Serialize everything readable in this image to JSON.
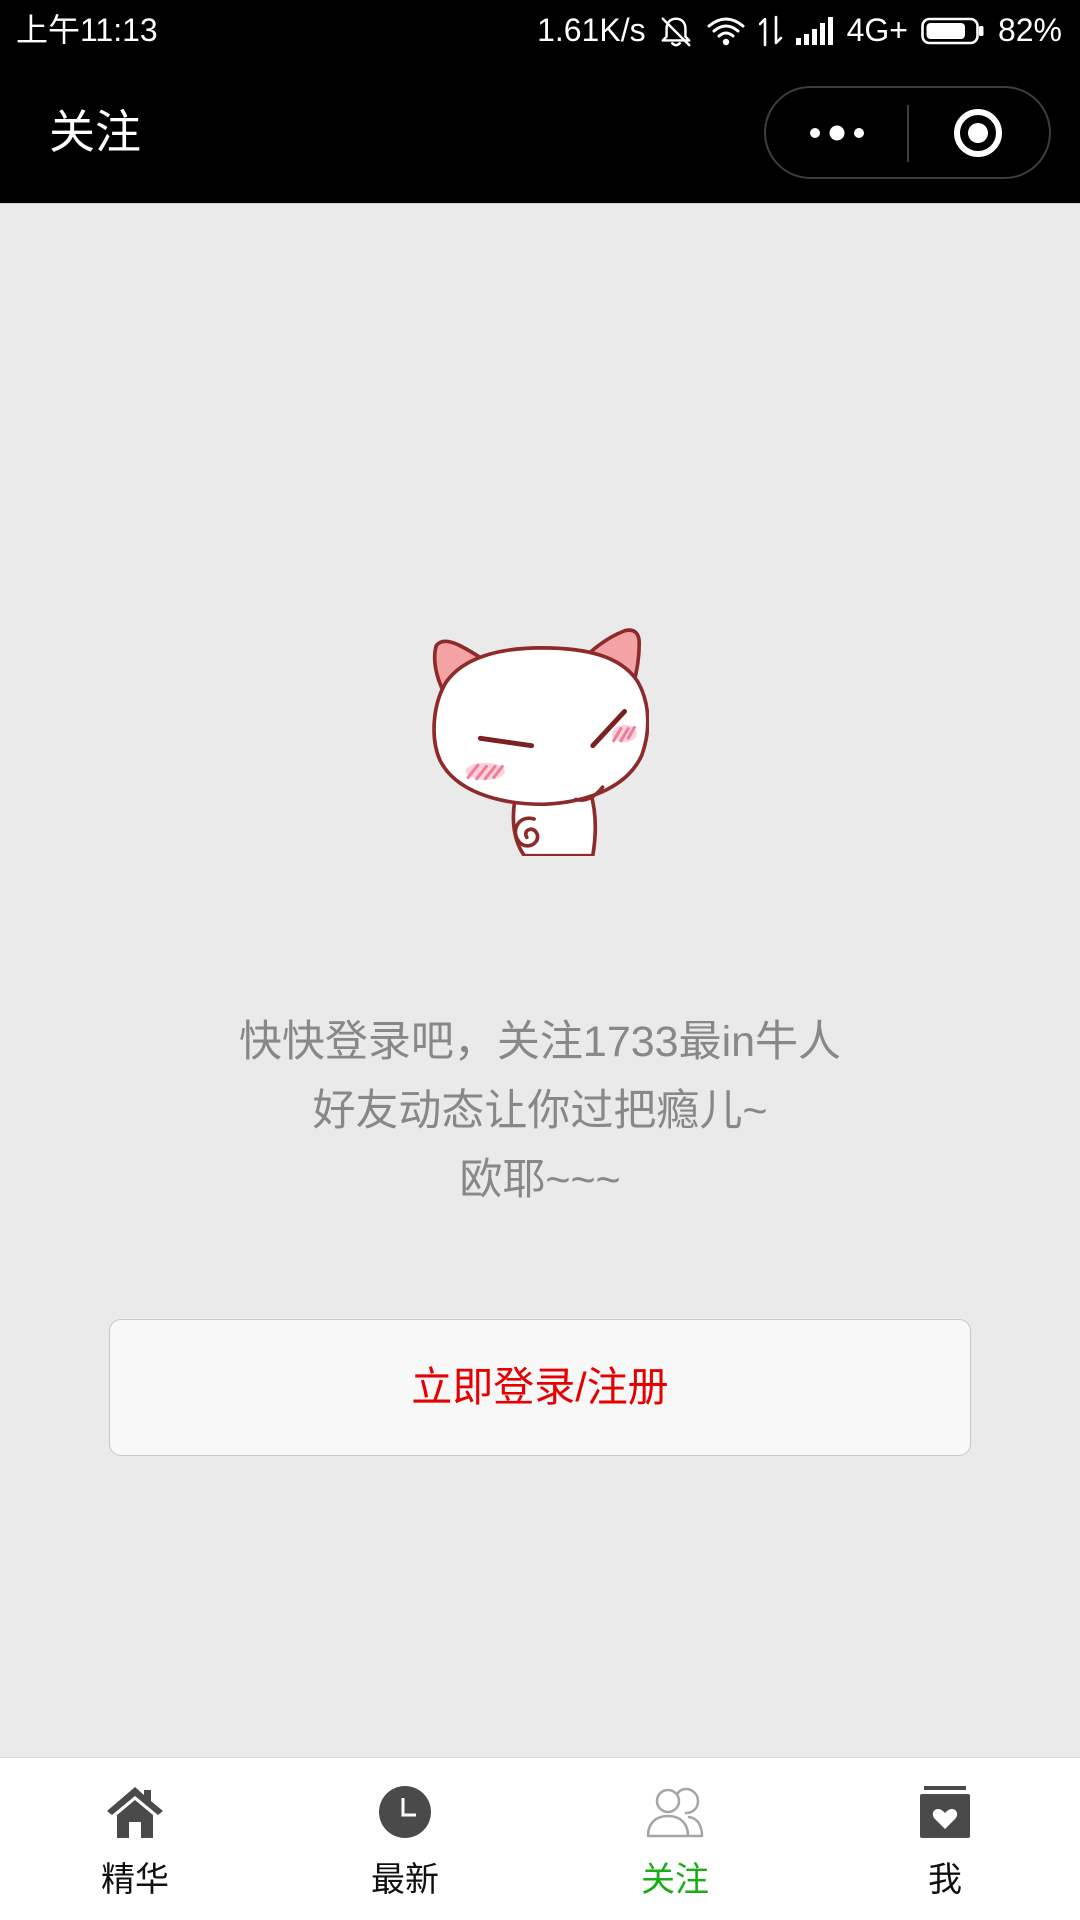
{
  "status_bar": {
    "time": "上午11:13",
    "network_speed": "1.61K/s",
    "network_type": "4G+",
    "battery_text": "82%",
    "battery_level": 0.82,
    "icons": [
      "mute-bell-icon",
      "wifi-icon",
      "data-arrows-icon",
      "signal-icon",
      "battery-icon"
    ]
  },
  "header": {
    "title": "关注",
    "capsule_icons": [
      "more-dots-icon",
      "target-circle-icon"
    ]
  },
  "main": {
    "illustration_icon": "cat-illustration",
    "message_lines": [
      "快快登录吧，关注1733最in牛人",
      "好友动态让你过把瘾儿~",
      "欧耶~~~"
    ],
    "login_button": "立即登录/注册"
  },
  "tab_bar": {
    "items": [
      {
        "label": "精华",
        "icon": "home-icon",
        "active": false
      },
      {
        "label": "最新",
        "icon": "clock-icon",
        "active": false
      },
      {
        "label": "关注",
        "icon": "people-icon",
        "active": true
      },
      {
        "label": "我",
        "icon": "heart-box-icon",
        "active": false
      }
    ]
  },
  "colors": {
    "bars": "#000000",
    "content_background": "#EAEAEA",
    "message_text": "#888888",
    "login_text": "#E60000",
    "tab_active": "#1AAD19",
    "tab_inactive": "#111111",
    "icon_dark": "#4A4A4A",
    "icon_light": "#A5A5A5"
  }
}
